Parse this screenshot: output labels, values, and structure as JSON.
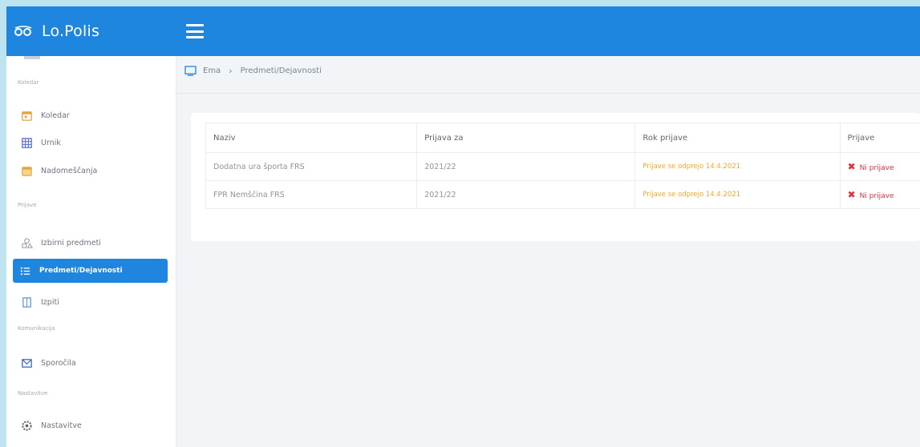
{
  "app": {
    "name": "Lo.Polis"
  },
  "sidebar": {
    "sections": [
      {
        "label": "Koledar"
      },
      {
        "label": "Prijave"
      },
      {
        "label": "Komunikacija"
      },
      {
        "label": "Nastavitve"
      }
    ],
    "items": [
      {
        "label": "Koledar",
        "icon": "calendar-icon"
      },
      {
        "label": "Urnik",
        "icon": "grid-icon"
      },
      {
        "label": "Nadomeščanja",
        "icon": "calendar-swap-icon"
      },
      {
        "label": "Izbirni predmeti",
        "icon": "shapes-icon"
      },
      {
        "label": "Predmeti/Dejavnosti",
        "icon": "list-icon",
        "active": true
      },
      {
        "label": "Izpiti",
        "icon": "document-icon"
      },
      {
        "label": "Sporočila",
        "icon": "mail-icon"
      },
      {
        "label": "Nastavitve",
        "icon": "gear-icon"
      }
    ]
  },
  "breadcrumb": {
    "home": "Ema",
    "current": "Predmeti/Dejavnosti"
  },
  "table": {
    "headers": [
      "Naziv",
      "Prijava za",
      "Rok prijave",
      "Prijave"
    ],
    "rows": [
      {
        "naziv": "Dodatna ura športa FRS",
        "prijava_za": "2021/22",
        "rok": "Prijave se odprejo 14.4.2021",
        "prijave": "Ni prijave"
      },
      {
        "naziv": "FPR Nemščina FRS",
        "prijava_za": "2021/22",
        "rok": "Prijave se odprejo 14.4.2021",
        "prijave": "Ni prijave"
      }
    ]
  },
  "colors": {
    "accent": "#1f86e0",
    "warning": "#f5a623",
    "danger": "#e0303a"
  }
}
